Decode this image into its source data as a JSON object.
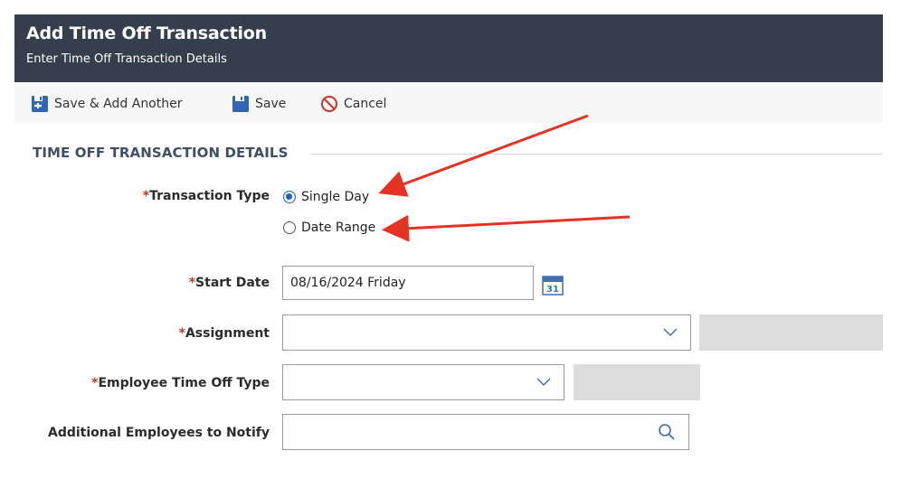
{
  "header": {
    "title": "Add Time Off Transaction",
    "subtitle": "Enter Time Off Transaction Details"
  },
  "toolbar": {
    "save_add_another_label": "Save & Add Another",
    "save_label": "Save",
    "cancel_label": "Cancel"
  },
  "section": {
    "title": "TIME OFF TRANSACTION DETAILS"
  },
  "form": {
    "transaction_type": {
      "required_mark": "*",
      "label": "Transaction Type",
      "options": [
        "Single Day",
        "Date Range"
      ],
      "selected": "Single Day"
    },
    "start_date": {
      "required_mark": "*",
      "label": "Start Date",
      "value": "08/16/2024 Friday",
      "calendar_day": "31"
    },
    "assignment": {
      "required_mark": "*",
      "label": "Assignment",
      "value": ""
    },
    "employee_time_off_type": {
      "required_mark": "*",
      "label": "Employee Time Off Type",
      "value": ""
    },
    "additional_employees": {
      "label": "Additional Employees to Notify",
      "value": ""
    }
  },
  "icons": {
    "save_add_another": "save-add-icon",
    "save": "save-icon",
    "cancel": "cancel-icon",
    "calendar": "calendar-icon",
    "dropdown": "chevron-down-icon",
    "search": "search-icon"
  },
  "colors": {
    "header_bg": "#343e4d",
    "accent_blue": "#1a5fd0",
    "section_title": "#3f4f66",
    "annotation_arrow": "#e53222"
  }
}
